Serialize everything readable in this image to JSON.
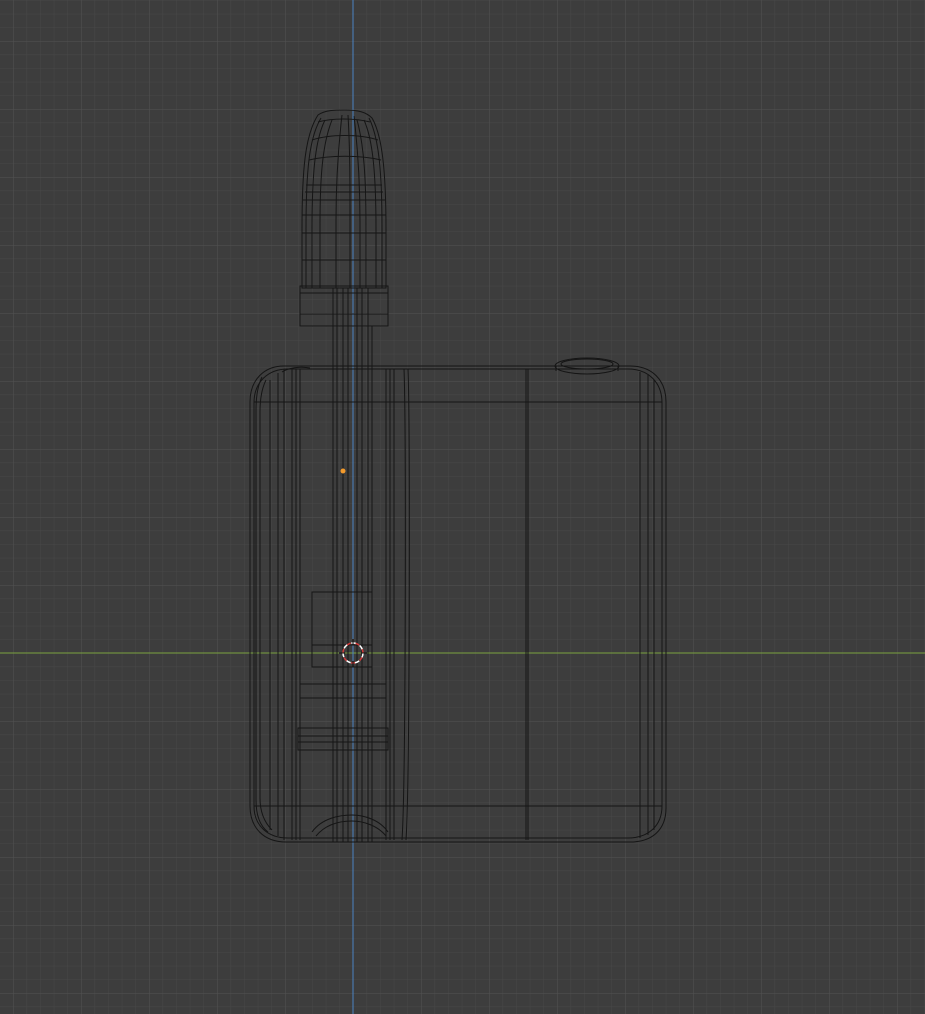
{
  "viewport": {
    "type": "3d-viewport",
    "shading": "wireframe",
    "view": "orthographic",
    "background_color": "#3d3d3d",
    "grid_minor_color": "#484848",
    "grid_major_color": "#525252",
    "x_axis_color": "#7ba23f",
    "z_axis_color": "#4a84c4",
    "wireframe_color": "#151515",
    "origin_marker_color": "#f39a2c",
    "cursor_ring_colors": [
      "#ffffff",
      "#d33a3a"
    ]
  },
  "scene": {
    "objects": [
      "mouthpiece",
      "device-body",
      "button"
    ],
    "origin_marker": "object-origin",
    "cursor": "3d-cursor"
  }
}
